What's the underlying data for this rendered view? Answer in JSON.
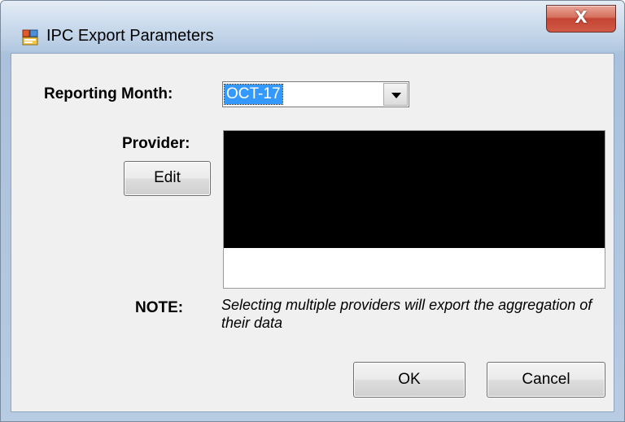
{
  "window": {
    "title": "IPC Export Parameters",
    "close_glyph": "X"
  },
  "form": {
    "reporting_month_label": "Reporting Month:",
    "reporting_month_value": "OCT-17",
    "provider_label": "Provider:",
    "edit_label": "Edit",
    "note_label": "NOTE:",
    "note_text": "Selecting multiple providers will export the aggregation of their data"
  },
  "buttons": {
    "ok_label": "OK",
    "cancel_label": "Cancel"
  },
  "colors": {
    "selection": "#3399ff",
    "close_button": "#c54433",
    "dialog_background": "#f0f0f0",
    "redaction": "#000000"
  },
  "icons": {
    "app": "window-form-icon",
    "close": "close-icon",
    "dropdown": "chevron-down-icon"
  }
}
